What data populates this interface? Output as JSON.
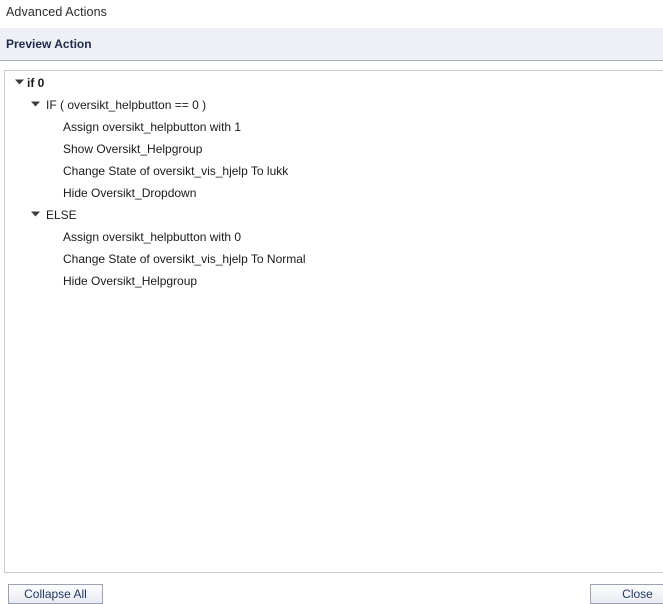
{
  "window": {
    "title": "Advanced Actions"
  },
  "preview_header": {
    "label": "Preview Action",
    "background_color": "#eef0f6",
    "text_color": "#1d2a4a"
  },
  "tree": {
    "expanded_icon": "caret-down-icon",
    "rows": [
      {
        "label": "if 0",
        "level": 0,
        "bold": true,
        "has_twisty": true
      },
      {
        "label": "IF ( oversikt_helpbutton == 0  )",
        "level": 1,
        "bold": false,
        "has_twisty": true
      },
      {
        "label": "Assign oversikt_helpbutton with 1",
        "level": 2,
        "bold": false,
        "has_twisty": false
      },
      {
        "label": "Show Oversikt_Helpgroup",
        "level": 2,
        "bold": false,
        "has_twisty": false
      },
      {
        "label": "Change State of oversikt_vis_hjelp To lukk",
        "level": 2,
        "bold": false,
        "has_twisty": false
      },
      {
        "label": "Hide Oversikt_Dropdown",
        "level": 2,
        "bold": false,
        "has_twisty": false
      },
      {
        "label": "ELSE",
        "level": 1,
        "bold": false,
        "has_twisty": true
      },
      {
        "label": "Assign oversikt_helpbutton with 0",
        "level": 2,
        "bold": false,
        "has_twisty": false
      },
      {
        "label": "Change State of oversikt_vis_hjelp To Normal",
        "level": 2,
        "bold": false,
        "has_twisty": false
      },
      {
        "label": "Hide Oversikt_Helpgroup",
        "level": 2,
        "bold": false,
        "has_twisty": false
      }
    ]
  },
  "footer": {
    "collapse_all_label": "Collapse All",
    "close_label": "Close",
    "button_text_color": "#1f3864"
  }
}
